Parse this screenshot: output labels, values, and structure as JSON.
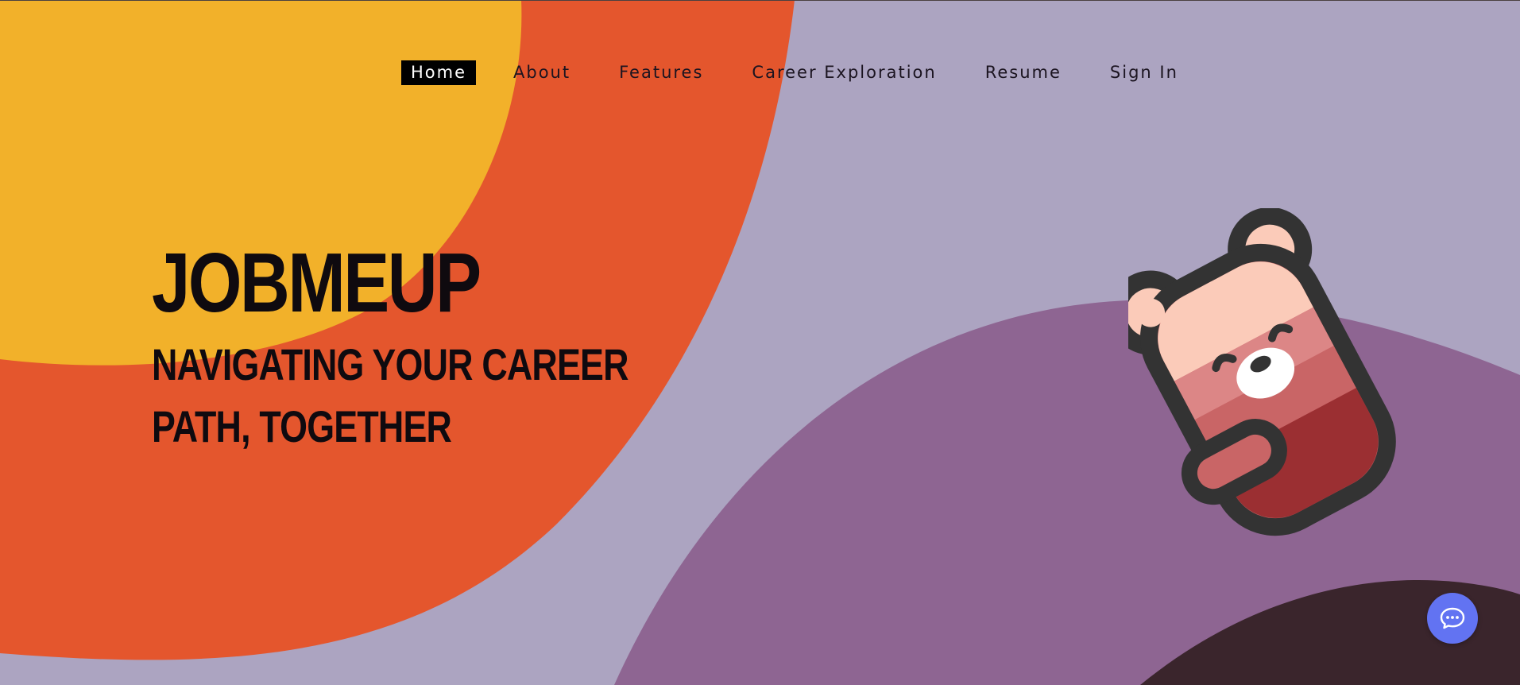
{
  "nav": {
    "items": [
      {
        "label": "Home",
        "active": true
      },
      {
        "label": "About",
        "active": false
      },
      {
        "label": "Features",
        "active": false
      },
      {
        "label": "Career Exploration",
        "active": false
      },
      {
        "label": "Resume",
        "active": false
      },
      {
        "label": "Sign In",
        "active": false
      }
    ]
  },
  "hero": {
    "title": "JOBMEUP",
    "subtitle": "NAVIGATING YOUR CAREER PATH, TOGETHER"
  },
  "colors": {
    "background": "#aca4c1",
    "yellow": "#f2b12a",
    "orange": "#e4562d",
    "purple": "#8e6592",
    "dark_plum": "#3a252c",
    "chat_button": "#6273f2",
    "active_nav_bg": "#000000"
  },
  "icons": {
    "chat": "chat-bubble-icon",
    "mascot": "bear-mascot-icon"
  }
}
